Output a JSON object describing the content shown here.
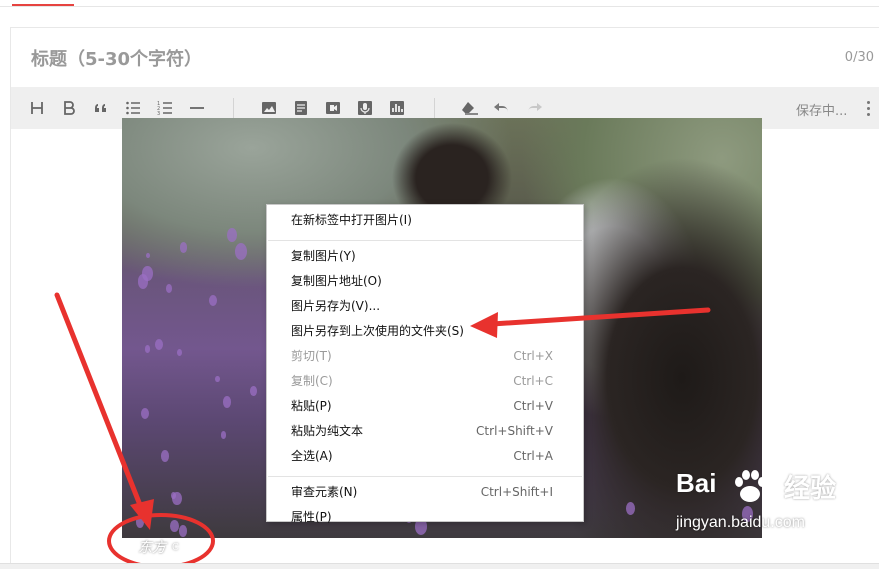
{
  "title_field": {
    "placeholder": "标题（5-30个字符）",
    "value": "",
    "counter": "0/30"
  },
  "toolbar": {
    "buttons": [
      {
        "icon": "heading-icon",
        "glyph": "H"
      },
      {
        "icon": "bold-icon",
        "glyph": "B"
      },
      {
        "icon": "quote-icon"
      },
      {
        "icon": "bullet-list-icon"
      },
      {
        "icon": "numbered-list-icon"
      },
      {
        "icon": "horizontal-rule-icon"
      },
      {
        "icon": "image-icon"
      },
      {
        "icon": "document-icon"
      },
      {
        "icon": "video-icon"
      },
      {
        "icon": "microphone-icon"
      },
      {
        "icon": "chart-icon"
      },
      {
        "icon": "clear-format-icon"
      },
      {
        "icon": "undo-icon"
      },
      {
        "icon": "redo-icon"
      }
    ],
    "status": "保存中...",
    "more_icon": "more-vertical-icon"
  },
  "context_menu": {
    "groups": [
      [
        {
          "label": "在新标签中打开图片(I)",
          "shortcut": "",
          "disabled": false
        }
      ],
      [
        {
          "label": "复制图片(Y)",
          "shortcut": "",
          "disabled": false
        },
        {
          "label": "复制图片地址(O)",
          "shortcut": "",
          "disabled": false
        },
        {
          "label": "图片另存为(V)...",
          "shortcut": "",
          "disabled": false
        },
        {
          "label": "图片另存到上次使用的文件夹(S)",
          "shortcut": "",
          "disabled": false
        },
        {
          "label": "剪切(T)",
          "shortcut": "Ctrl+X",
          "disabled": true
        },
        {
          "label": "复制(C)",
          "shortcut": "Ctrl+C",
          "disabled": true
        },
        {
          "label": "粘贴(P)",
          "shortcut": "Ctrl+V",
          "disabled": false
        },
        {
          "label": "粘贴为纯文本",
          "shortcut": "Ctrl+Shift+V",
          "disabled": false
        },
        {
          "label": "全选(A)",
          "shortcut": "Ctrl+A",
          "disabled": false
        }
      ],
      [
        {
          "label": "审查元素(N)",
          "shortcut": "Ctrl+Shift+I",
          "disabled": false
        },
        {
          "label": "属性(P)",
          "shortcut": "",
          "disabled": false
        }
      ]
    ]
  },
  "photo": {
    "stamp_text": "东方",
    "stamp_symbol": "C"
  },
  "watermark": {
    "brand": "Bai",
    "brand_suffix": "经验",
    "url": "jingyan.baidu.com"
  },
  "annotation_color": "#e8322e",
  "accent_color": "#e64340"
}
